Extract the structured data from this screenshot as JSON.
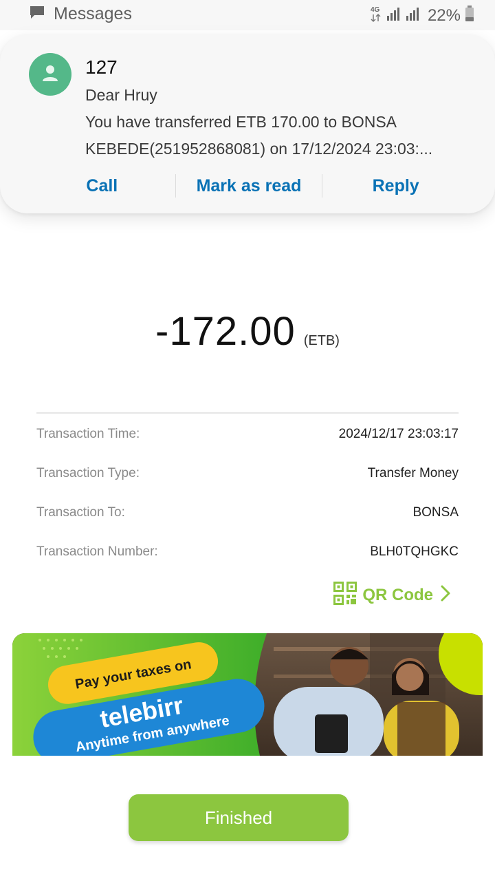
{
  "status_bar": {
    "app_name": "Messages",
    "network": "4G",
    "battery": "22%"
  },
  "notification": {
    "sender": "127",
    "lines": [
      "Dear Hruy",
      "You have transferred ETB 170.00 to BONSA",
      "KEBEDE(251952868081) on 17/12/2024 23:03:..."
    ],
    "actions": {
      "call": "Call",
      "mark_read": "Mark as read",
      "reply": "Reply"
    }
  },
  "transaction": {
    "amount": "-172.00",
    "currency": "(ETB)",
    "rows": [
      {
        "label": "Transaction Time:",
        "value": "2024/12/17 23:03:17"
      },
      {
        "label": "Transaction Type:",
        "value": "Transfer Money"
      },
      {
        "label": "Transaction To:",
        "value": "BONSA"
      },
      {
        "label": "Transaction Number:",
        "value": "BLH0TQHGKC"
      }
    ],
    "qr_label": "QR Code"
  },
  "banner": {
    "line1": "Pay your taxes on",
    "brand": "telebirr",
    "line2": "Anytime from anywhere"
  },
  "finish_label": "Finished",
  "colors": {
    "accent_green": "#8cc63f",
    "link_blue": "#0a72b5",
    "avatar_green": "#54b889"
  }
}
